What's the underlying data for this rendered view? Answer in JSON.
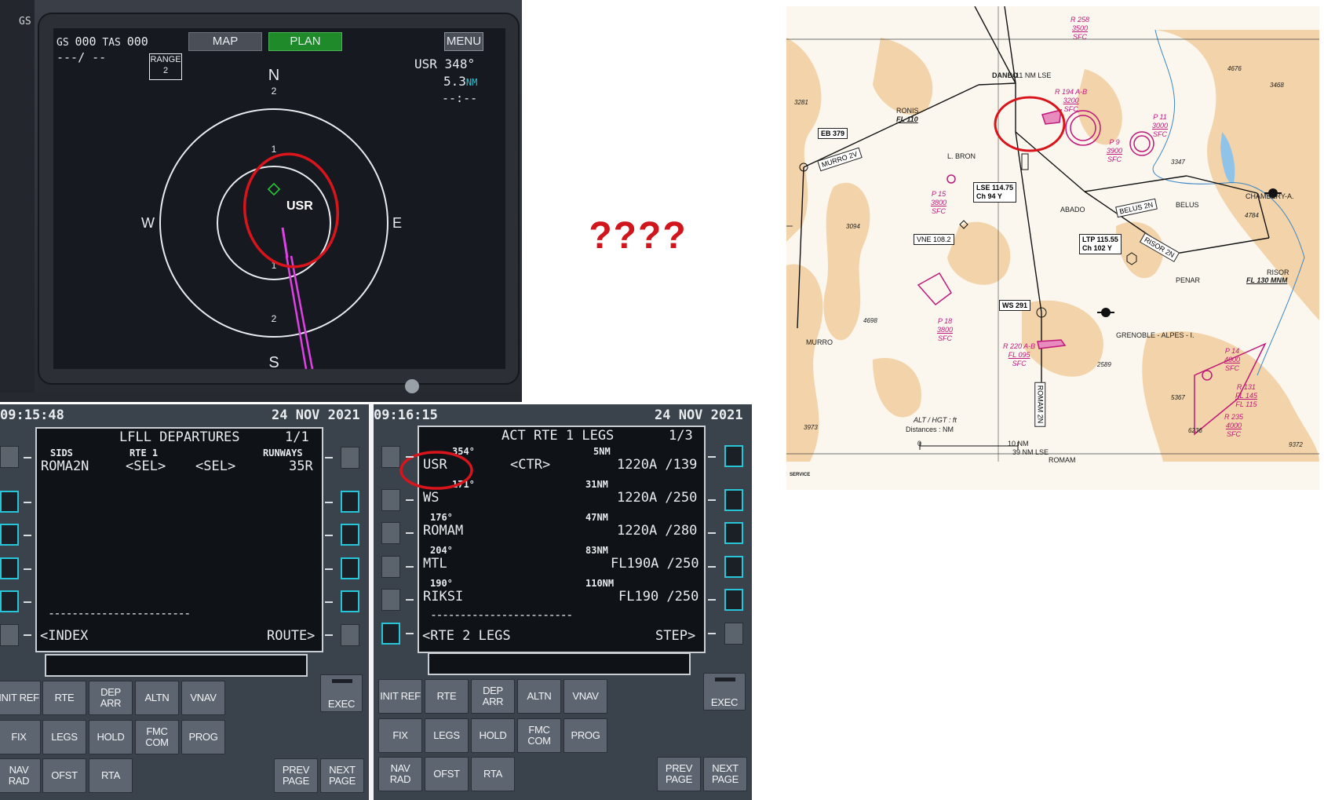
{
  "nd": {
    "gs_label": "GS",
    "gs_value": "000",
    "tas_label": "TAS",
    "tas_value": "000",
    "wind": "---/ --",
    "range_label": "RANGE",
    "range_value": "2",
    "btn_map": "MAP",
    "btn_plan": "PLAN",
    "btn_menu": "MENU",
    "wpt_name": "USR",
    "wpt_brg": "348°",
    "wpt_dist": "5.3",
    "wpt_dist_unit": "NM",
    "wpt_eta": "--:--",
    "compass": {
      "n": "N",
      "s": "S",
      "e": "E",
      "w": "W"
    },
    "ring_labels": [
      "2",
      "1",
      "1",
      "2"
    ],
    "waypoint_label": "USR",
    "edge_text": "GS",
    "colors": {
      "plan_btn": "#1f8a2a",
      "map_btn": "#4a4f57",
      "route": "#e33fe8",
      "highlight": "#d9141b",
      "waypoint": "#27d13a",
      "nm_unit": "#26c6d8"
    }
  },
  "question": {
    "text": "????"
  },
  "fmc_left": {
    "time": "09:15:48",
    "date": "24 NOV 2021",
    "title": "LFLL DEPARTURES",
    "page": "1/1",
    "hdr_sids": "SIDS",
    "hdr_rte": "RTE 1",
    "hdr_runways": "RUNWAYS",
    "row1_sid": "ROMA2N",
    "row1_sel1": "<SEL>",
    "row1_sel2": "<SEL>",
    "row1_rwy": "35R",
    "dashes": "------------------------",
    "l6": "<INDEX",
    "r6": "ROUTE>"
  },
  "fmc_right": {
    "time": "09:16:15",
    "date": "24 NOV 2021",
    "title": "ACT RTE 1 LEGS",
    "page": "1/3",
    "legs": [
      {
        "crs": "354°",
        "dist": "5NM",
        "name": "USR",
        "mid": "<CTR>",
        "constraint": "1220A /139"
      },
      {
        "crs": "171°",
        "dist": "31NM",
        "name": "WS",
        "mid": "",
        "constraint": "1220A /250"
      },
      {
        "crs": "176°",
        "dist": "47NM",
        "name": "ROMAM",
        "mid": "",
        "constraint": "1220A /280"
      },
      {
        "crs": "204°",
        "dist": "83NM",
        "name": "MTL",
        "mid": "",
        "constraint": "FL190A /250"
      },
      {
        "crs": "190°",
        "dist": "110NM",
        "name": "RIKSI",
        "mid": "",
        "constraint": "FL190 /250"
      }
    ],
    "dashes": "------------------------",
    "l6": "<RTE 2 LEGS",
    "r6": "STEP>"
  },
  "keys": {
    "row1": [
      "INIT REF",
      "RTE",
      "DEP ARR",
      "ALTN",
      "VNAV"
    ],
    "row2": [
      "FIX",
      "LEGS",
      "HOLD",
      "FMC COM",
      "PROG"
    ],
    "row3": [
      "NAV RAD",
      "OFST",
      "RTA"
    ],
    "exec": "EXEC",
    "prev": "PREV PAGE",
    "next": "NEXT PAGE"
  },
  "chart": {
    "fixes": [
      "DANBO",
      "RONIS",
      "L. BRON",
      "ABADO",
      "BELUS",
      "CHAMBERY-A.",
      "MURRO",
      "PENAR",
      "RISOR",
      "ROMAM",
      "GRENOBLE - ALPES - I."
    ],
    "ronis_fl": "FL 110",
    "risor_fl": "FL 130 MNM",
    "boxes": {
      "eb379": "EB 379",
      "lse": "LSE 114.75",
      "lse_ch": "Ch 94 Y",
      "vne": "VNE 108.2",
      "ltp": "LTP 115.55",
      "ltp_ch": "Ch 102 Y",
      "ws": "WS 291"
    },
    "procedures": {
      "murro2v": "MURRO 2V",
      "belus2n": "BELUS 2N",
      "risor2n": "RISOR 2N",
      "romam2n": "ROMAM 2N"
    },
    "restricted": [
      {
        "id": "R 258",
        "top": "3500",
        "bottom": "SFC"
      },
      {
        "id": "R 194 A-B",
        "top": "3200",
        "bottom": "SFC"
      },
      {
        "id": "P 9",
        "top": "3900",
        "bottom": "SFC"
      },
      {
        "id": "P 11",
        "top": "3000",
        "bottom": "SFC"
      },
      {
        "id": "P 15",
        "top": "3800",
        "bottom": "SFC"
      },
      {
        "id": "P 18",
        "top": "3800",
        "bottom": "SFC"
      },
      {
        "id": "R 220 A-B",
        "top": "FL 095",
        "bottom": "SFC"
      },
      {
        "id": "P 14",
        "top": "4000",
        "bottom": "SFC"
      },
      {
        "id": "R 131",
        "top": "FL 145",
        "bottom": "FL 115"
      },
      {
        "id": "R 235",
        "top": "4000",
        "bottom": "SFC"
      }
    ],
    "elevations": [
      "4676",
      "3468",
      "3281",
      "3094",
      "4698",
      "3973",
      "2589",
      "5367",
      "6236",
      "9372",
      "4784",
      "3347"
    ],
    "legend_alt": "ALT / HGT : ft",
    "legend_dist": "Distances : NM",
    "scale_0": "0",
    "scale_10": "10 NM",
    "dist_romam": "39 NM LSE",
    "dist_danbo": "11 NM LSE",
    "footer": "SERVICE",
    "colors": {
      "terrain": "#f3d4aa",
      "restricted": "#c0187a",
      "route": "#111111",
      "water": "#8fc4e8"
    }
  }
}
